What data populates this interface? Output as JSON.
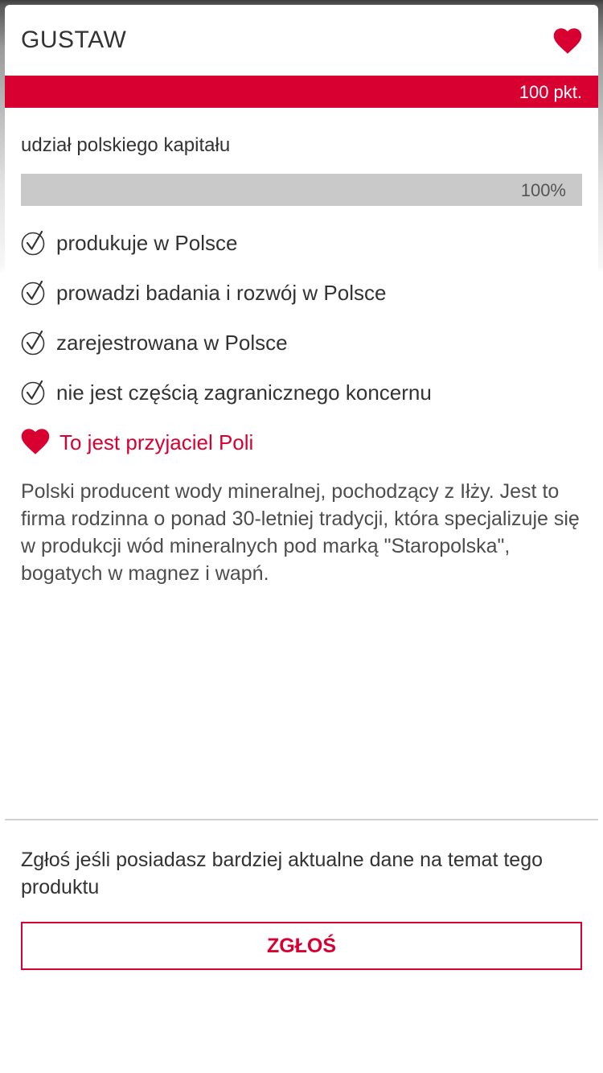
{
  "product": {
    "title": "GUSTAW",
    "score": "100 pkt."
  },
  "capital": {
    "label": "udział polskiego kapitału",
    "value_text": "100%",
    "value": 100
  },
  "criteria": [
    {
      "label": "produkuje w Polsce",
      "icon": "check-circle-icon"
    },
    {
      "label": "prowadzi badania i rozwój w Polsce",
      "icon": "check-circle-icon"
    },
    {
      "label": "zarejestrowana w Polsce",
      "icon": "check-circle-icon"
    },
    {
      "label": "nie jest częścią zagranicznego koncernu",
      "icon": "check-circle-icon"
    }
  ],
  "friend": {
    "label": "To jest przyjaciel Poli",
    "icon": "heart-icon"
  },
  "description": "Polski producent wody mineralnej, pochodzący z Iłży. Jest to firma rodzinna o ponad 30-letniej tradycji, która specjalizuje się w produkcji wód mineralnych pod marką \"Staropolska\", bogatych w magnez i wapń.",
  "report": {
    "prompt": "Zgłoś jeśli posiadasz bardziej aktualne dane na temat tego produktu",
    "button_label": "ZGŁOŚ"
  },
  "colors": {
    "accent": "#d80030",
    "progress_fill": "#c9c9c9",
    "text": "#333333"
  }
}
